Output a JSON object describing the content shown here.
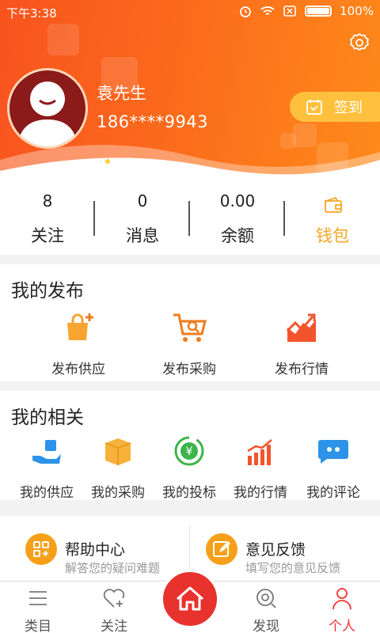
{
  "status_bar": {
    "time": "下午3:38",
    "battery": "100%"
  },
  "profile": {
    "name": "袁先生",
    "phone": "186****9943",
    "signin_label": "签到"
  },
  "stats": [
    {
      "value": "8",
      "label": "关注"
    },
    {
      "value": "0",
      "label": "消息"
    },
    {
      "value": "0.00",
      "label": "余额"
    },
    {
      "value": "",
      "label": "钱包"
    }
  ],
  "publish": {
    "title": "我的发布",
    "items": [
      {
        "label": "发布供应",
        "icon": "bag-plus-icon"
      },
      {
        "label": "发布采购",
        "icon": "cart-search-icon"
      },
      {
        "label": "发布行情",
        "icon": "trend-chart-icon"
      }
    ]
  },
  "related": {
    "title": "我的相关",
    "items": [
      {
        "label": "我的供应",
        "icon": "hand-supply-icon"
      },
      {
        "label": "我的采购",
        "icon": "box-icon"
      },
      {
        "label": "我的投标",
        "icon": "yuan-coin-icon"
      },
      {
        "label": "我的行情",
        "icon": "bar-chart-icon"
      },
      {
        "label": "我的评论",
        "icon": "comment-icon"
      }
    ]
  },
  "help": [
    {
      "title": "帮助中心",
      "subtitle": "解答您的疑问难题"
    },
    {
      "title": "意见反馈",
      "subtitle": "填写您的意见反馈"
    }
  ],
  "tabs": [
    {
      "label": "类目",
      "icon": "list-icon"
    },
    {
      "label": "关注",
      "icon": "heart-plus-icon"
    },
    {
      "label": "",
      "icon": "home-icon"
    },
    {
      "label": "发现",
      "icon": "discover-icon"
    },
    {
      "label": "个人",
      "icon": "person-icon",
      "active": true
    }
  ],
  "colors": {
    "header": "#f8531e",
    "accent": "#f5a623",
    "tab_active": "#e33333",
    "home": "#e8322e"
  }
}
